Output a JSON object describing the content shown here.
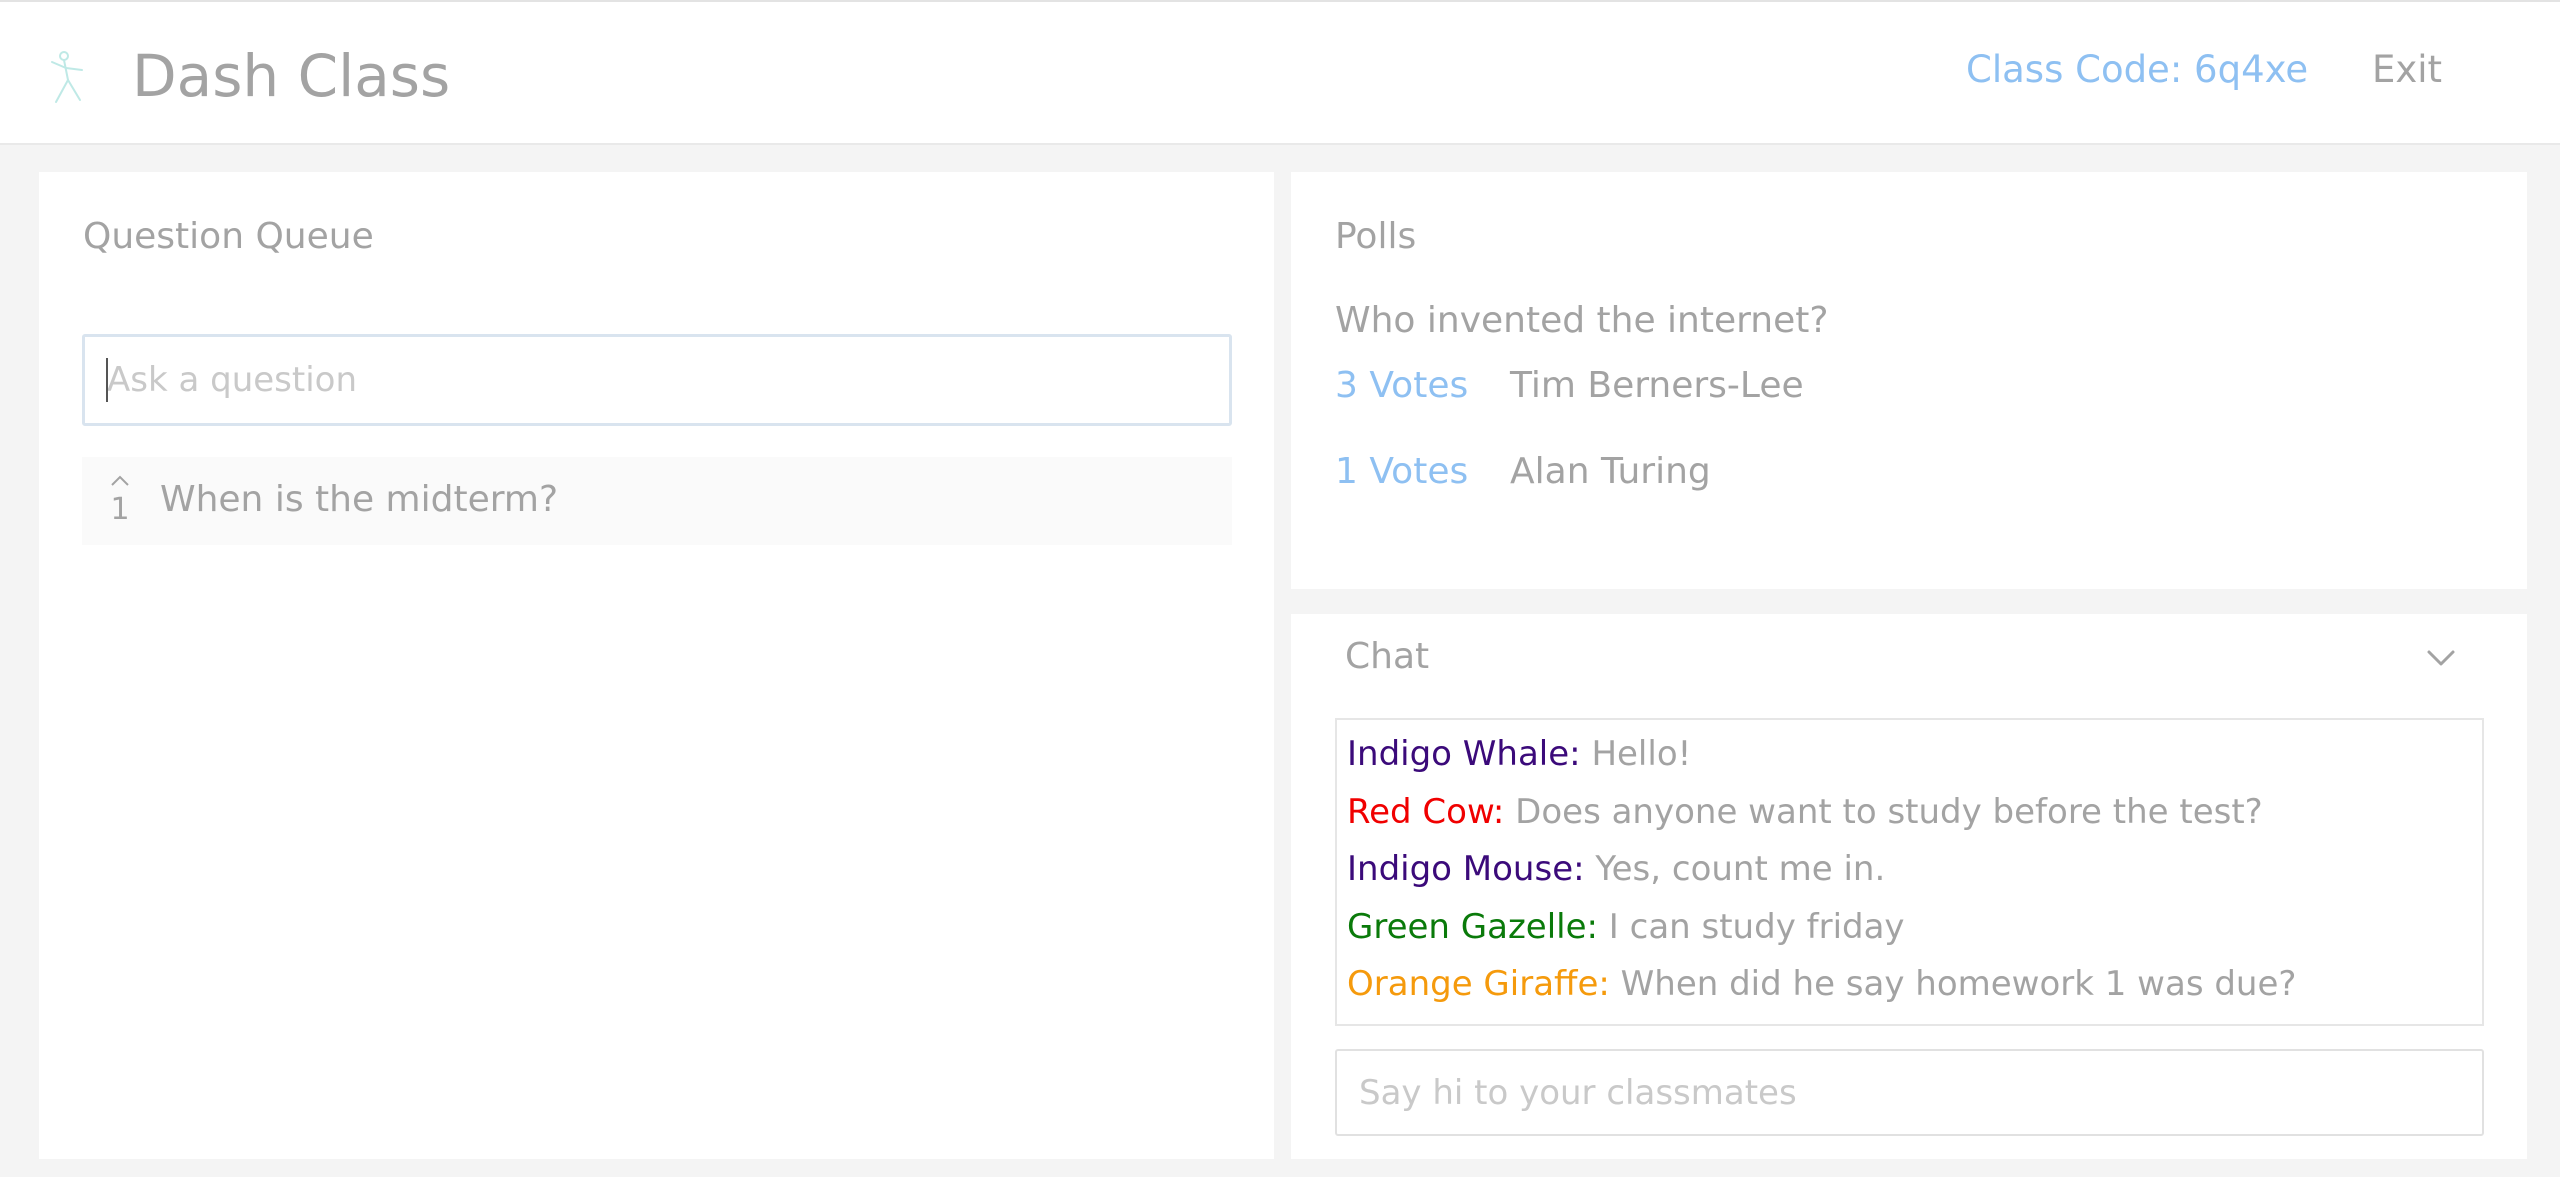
{
  "header": {
    "app_title": "Dash Class",
    "class_code": "Class Code: 6q4xe",
    "exit_label": "Exit",
    "logo_icon": "stick-figure-logo-icon"
  },
  "colors": {
    "accent_blue": "#8ec0f2",
    "text_gray": "#a3a3a3",
    "background": "#f4f4f4"
  },
  "question_queue": {
    "title": "Question Queue",
    "input_placeholder": "Ask a question",
    "questions": [
      {
        "votes": "1",
        "text": "When is the midterm?",
        "upvote_icon": "caret-up-icon"
      }
    ]
  },
  "polls": {
    "title": "Polls",
    "question": "Who invented the internet?",
    "options": [
      {
        "votes": "3 Votes",
        "label": "Tim Berners-Lee"
      },
      {
        "votes": "1 Votes",
        "label": "Alan Turing"
      }
    ]
  },
  "chat": {
    "title": "Chat",
    "toggle_icon": "chevron-down-icon",
    "input_placeholder": "Say hi to your classmates",
    "messages": [
      {
        "author": "Indigo Whale:",
        "author_color": "#3b0a7a",
        "text": "Hello!"
      },
      {
        "author": "Red Cow:",
        "author_color": "#f00000",
        "text": "Does anyone want to study before the test?"
      },
      {
        "author": "Indigo Mouse:",
        "author_color": "#3b0a7a",
        "text": "Yes, count me in."
      },
      {
        "author": "Green Gazelle:",
        "author_color": "#0a7a0a",
        "text": "I can study friday"
      },
      {
        "author": "Orange Giraffe:",
        "author_color": "#f59a0c",
        "text": "When did he say homework 1 was due?"
      }
    ]
  }
}
